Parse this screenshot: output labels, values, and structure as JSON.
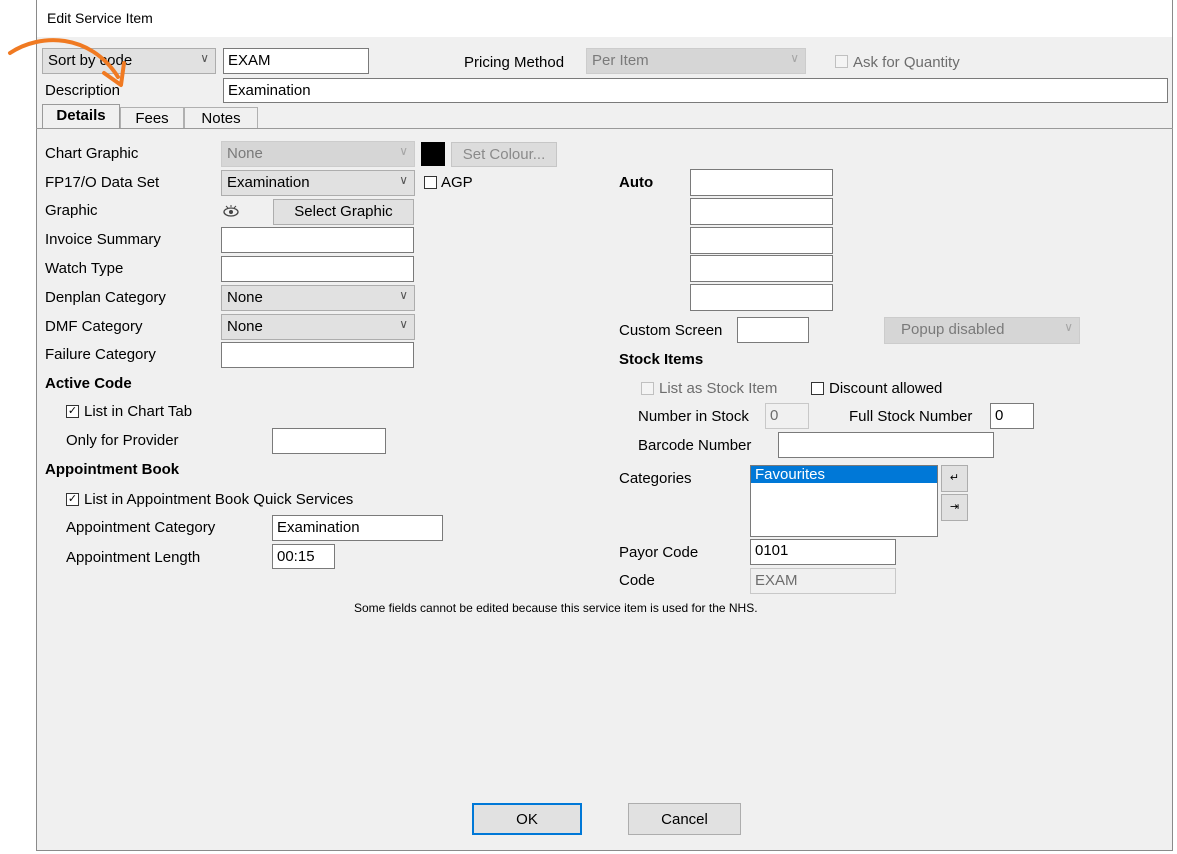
{
  "window": {
    "title": "Edit Service Item"
  },
  "top": {
    "sort_select": "Sort by code",
    "code_value": "EXAM",
    "pricing_method_label": "Pricing Method",
    "pricing_method_value": "Per Item",
    "ask_quantity_label": "Ask for Quantity",
    "description_label": "Description",
    "description_value": "Examination"
  },
  "tabs": [
    "Details",
    "Fees",
    "Notes"
  ],
  "left": {
    "chart_graphic_label": "Chart Graphic",
    "chart_graphic_value": "None",
    "set_colour_label": "Set Colour...",
    "fp17_label": "FP17/O Data Set",
    "fp17_value": "Examination",
    "agp_label": "AGP",
    "graphic_label": "Graphic",
    "select_graphic_label": "Select Graphic",
    "invoice_summary_label": "Invoice Summary",
    "watch_type_label": "Watch Type",
    "denplan_label": "Denplan Category",
    "denplan_value": "None",
    "dmf_label": "DMF Category",
    "dmf_value": "None",
    "failure_label": "Failure Category",
    "active_code_heading": "Active Code",
    "list_chart_tab_label": "List in Chart Tab",
    "only_provider_label": "Only for Provider",
    "appointment_book_heading": "Appointment Book",
    "list_quick_services_label": "List in Appointment Book Quick Services",
    "appointment_category_label": "Appointment Category",
    "appointment_category_value": "Examination",
    "appointment_length_label": "Appointment Length",
    "appointment_length_value": "00:15"
  },
  "right": {
    "auto_label": "Auto",
    "custom_screen_label": "Custom Screen",
    "popup_value": "Popup disabled",
    "stock_items_heading": "Stock Items",
    "list_stock_label": "List as Stock Item",
    "discount_label": "Discount allowed",
    "number_in_stock_label": "Number in Stock",
    "number_in_stock_value": "0",
    "full_stock_label": "Full Stock Number",
    "full_stock_value": "0",
    "barcode_label": "Barcode Number",
    "categories_label": "Categories",
    "categories_items": [
      "Favourites"
    ],
    "payor_code_label": "Payor Code",
    "payor_code_value": "0101",
    "code_label": "Code",
    "code_value": "EXAM"
  },
  "note": "Some fields cannot be edited because this service item is used for the NHS.",
  "buttons": {
    "ok": "OK",
    "cancel": "Cancel"
  },
  "colors": {
    "accent": "#0078d7",
    "annotation_arrow": "#f07a22",
    "swatch": "#000000"
  }
}
